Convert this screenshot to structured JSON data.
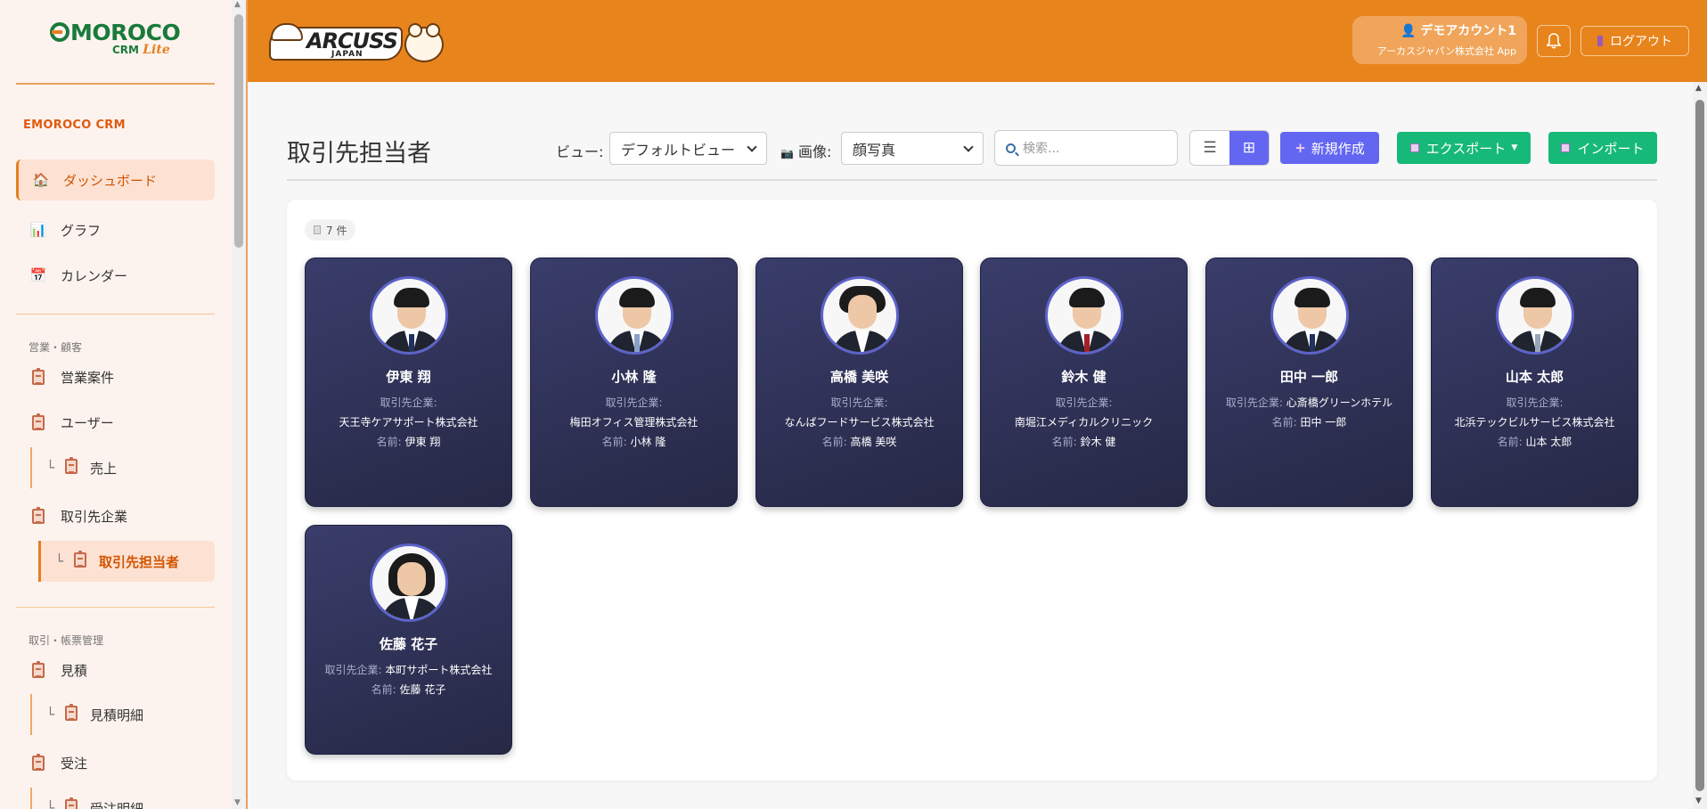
{
  "sidebar": {
    "logo_main": "MOROCO",
    "logo_sub_a": "CRM",
    "logo_sub_b": "Lite",
    "brand": "EMOROCO CRM",
    "items": [
      {
        "label": "ダッシュボード",
        "icon": "house-icon"
      },
      {
        "label": "グラフ",
        "icon": "bar-chart-icon"
      },
      {
        "label": "カレンダー",
        "icon": "calendar-icon"
      }
    ],
    "section_sales": "営業・顧客",
    "sales_items": [
      "営業案件",
      "ユーザー",
      "売上",
      "取引先企業",
      "取引先担当者"
    ],
    "section_docs": "取引・帳票管理",
    "doc_items": [
      "見積",
      "見積明細",
      "受注",
      "受注明細"
    ]
  },
  "header": {
    "brand": "ARCUSS",
    "brand_sub": "JAPAN",
    "account_name": "デモアカウント1",
    "account_company": "アーカスジャパン株式会社 App",
    "logout": "ログアウト"
  },
  "toolbar": {
    "title": "取引先担当者",
    "view_label": "ビュー:",
    "view_value": "デフォルトビュー",
    "image_label": "画像:",
    "image_value": "顔写真",
    "search_placeholder": "検索...",
    "new_label": "新規作成",
    "export_label": "エクスポート",
    "import_label": "インポート"
  },
  "count_label": "7 件",
  "labels": {
    "company": "取引先企業:",
    "name": "名前:"
  },
  "cards": [
    {
      "name": "伊東 翔",
      "company": "天王寺ケアサポート株式会社",
      "person": "伊東 翔"
    },
    {
      "name": "小林 隆",
      "company": "梅田オフィス管理株式会社",
      "person": "小林 隆"
    },
    {
      "name": "高橋 美咲",
      "company": "なんばフードサービス株式会社",
      "person": "高橋 美咲"
    },
    {
      "name": "鈴木 健",
      "company": "南堀江メディカルクリニック",
      "person": "鈴木 健"
    },
    {
      "name": "田中 一郎",
      "company": "心斎橋グリーンホテル",
      "person": "田中 一郎"
    },
    {
      "name": "山本 太郎",
      "company": "北浜テックビルサービス株式会社",
      "person": "山本 太郎"
    },
    {
      "name": "佐藤 花子",
      "company": "本町サポート株式会社",
      "person": "佐藤 花子"
    }
  ]
}
